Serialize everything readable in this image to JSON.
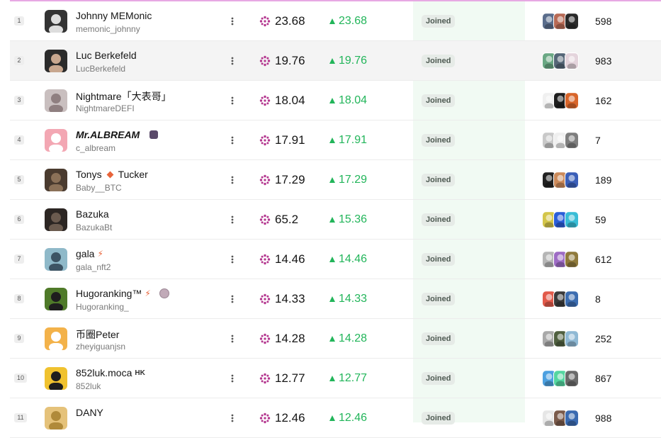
{
  "status_label": "Joined",
  "colors": {
    "accent_line": "#e7a8e3",
    "change_green": "#22b55a",
    "score_icon": "#b4378f",
    "joined_bg": "#f1faf3"
  },
  "icons": {
    "score": "flower-icon",
    "change": "up-triangle-icon",
    "menu": "kebab-icon"
  },
  "rows": [
    {
      "rank": "1",
      "name": "Johnny MEMonic",
      "handle": "memonic_johnny",
      "score": "23.68",
      "change": "23.68",
      "count": "598",
      "avatar": [
        "#333333",
        "#dddddd"
      ],
      "minis": [
        "#5a6d8c",
        "#b86a55",
        "#2a2a2a"
      ]
    },
    {
      "rank": "2",
      "name": "Luc Berkefeld",
      "handle": "LucBerkefeld",
      "score": "19.76",
      "change": "19.76",
      "count": "983",
      "avatar": [
        "#2b2b2b",
        "#c8a78f"
      ],
      "minis": [
        "#6aa884",
        "#556677",
        "#e4d4dc"
      ]
    },
    {
      "rank": "3",
      "name": "Nightmare「大表哥」",
      "handle": "NightmareDEFI",
      "score": "18.04",
      "change": "18.04",
      "count": "162",
      "avatar": [
        "#c9bfbf",
        "#8f7f80"
      ],
      "minis": [
        "#f0f0f0",
        "#1e1e1e",
        "#d8652a"
      ]
    },
    {
      "rank": "4",
      "name": "Mr.ALBREAM",
      "handle": "c_albream",
      "score": "17.91",
      "change": "17.91",
      "count": "7",
      "avatar": [
        "#f3a7b3",
        "#ffffff"
      ],
      "minis": [
        "#c9c9c9",
        "#efefef",
        "#7e7e7e"
      ]
    },
    {
      "rank": "5",
      "name": "Tonys",
      "name_suffix": "Tucker",
      "handle": "Baby__BTC",
      "score": "17.29",
      "change": "17.29",
      "count": "189",
      "avatar": [
        "#4a3b2f",
        "#8b7158"
      ],
      "minis": [
        "#222222",
        "#cc8a5a",
        "#3b5fb8"
      ]
    },
    {
      "rank": "6",
      "name": "Bazuka",
      "handle": "BazukaBt",
      "score": "65.2",
      "change": "15.36",
      "count": "59",
      "avatar": [
        "#2c2623",
        "#6b5b4f"
      ],
      "minis": [
        "#d4c64a",
        "#2a5ed8",
        "#39bdd6"
      ]
    },
    {
      "rank": "7",
      "name": "gala",
      "handle": "gala_nft2",
      "score": "14.46",
      "change": "14.46",
      "count": "612",
      "avatar": [
        "#8fb9c9",
        "#3d5464"
      ],
      "minis": [
        "#b6b6b6",
        "#9d6bc4",
        "#8f7a3b"
      ]
    },
    {
      "rank": "8",
      "name": "Hugoranking™",
      "handle": "Hugoranking_",
      "score": "14.33",
      "change": "14.33",
      "count": "8",
      "avatar": [
        "#4f7a29",
        "#1e1e1e"
      ],
      "minis": [
        "#e25a4a",
        "#3a3a3a",
        "#3c6db0"
      ]
    },
    {
      "rank": "9",
      "name": "币圈Peter",
      "handle": "zheyiguanjsn",
      "score": "14.28",
      "change": "14.28",
      "count": "252",
      "avatar": [
        "#f3b24a",
        "#ffffff"
      ],
      "minis": [
        "#a9a9a9",
        "#4f5f3f",
        "#8fb9d4"
      ]
    },
    {
      "rank": "10",
      "name": "852luk.moca",
      "name_suffix": "HK",
      "handle": "852luk",
      "score": "12.77",
      "change": "12.77",
      "count": "867",
      "avatar": [
        "#f0c22f",
        "#1e1e1e"
      ],
      "minis": [
        "#4da0e0",
        "#54d6a0",
        "#6a6a6a"
      ]
    },
    {
      "rank": "11",
      "name": "DANY",
      "handle": "",
      "score": "12.46",
      "change": "12.46",
      "count": "988",
      "avatar": [
        "#e5c27a",
        "#b08a3a"
      ],
      "minis": [
        "#e6e6e6",
        "#7a5a4a",
        "#3a6ab0"
      ]
    }
  ]
}
